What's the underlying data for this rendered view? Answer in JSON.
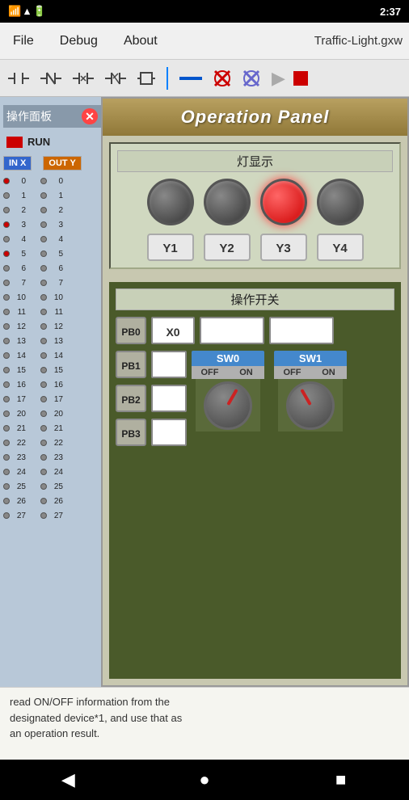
{
  "statusBar": {
    "time": "2:37",
    "icons": [
      "wifi",
      "signal",
      "battery"
    ]
  },
  "menuBar": {
    "file": "File",
    "debug": "Debug",
    "about": "About",
    "fileTitle": "Traffic-Light.gxw"
  },
  "toolbar": {
    "icons": [
      "contact-no",
      "contact-nc",
      "contact-p",
      "contact-n",
      "coil"
    ],
    "divider": true,
    "line": "—",
    "x1": "✕",
    "x2": "✕",
    "play": "▶",
    "stop": "■"
  },
  "leftPanel": {
    "title": "操作面板",
    "runLabel": "RUN",
    "inLabel": "IN X",
    "outLabel": "OUT Y",
    "ioRows": [
      {
        "in": "0",
        "inOn": true,
        "out": "0",
        "outOn": false
      },
      {
        "in": "1",
        "inOn": false,
        "out": "1",
        "outOn": false
      },
      {
        "in": "2",
        "inOn": false,
        "out": "2",
        "outOn": false
      },
      {
        "in": "3",
        "inOn": true,
        "out": "3",
        "outOn": false
      },
      {
        "in": "4",
        "inOn": false,
        "out": "4",
        "outOn": false
      },
      {
        "in": "5",
        "inOn": true,
        "out": "5",
        "outOn": false
      },
      {
        "in": "6",
        "inOn": false,
        "out": "6",
        "outOn": false
      },
      {
        "in": "7",
        "inOn": false,
        "out": "7",
        "outOn": false
      },
      {
        "in": "10",
        "inOn": false,
        "out": "10",
        "outOn": false
      },
      {
        "in": "11",
        "inOn": false,
        "out": "11",
        "outOn": false
      },
      {
        "in": "12",
        "inOn": false,
        "out": "12",
        "outOn": false
      },
      {
        "in": "13",
        "inOn": false,
        "out": "13",
        "outOn": false
      },
      {
        "in": "14",
        "inOn": false,
        "out": "14",
        "outOn": false
      },
      {
        "in": "15",
        "inOn": false,
        "out": "15",
        "outOn": false
      },
      {
        "in": "16",
        "inOn": false,
        "out": "16",
        "outOn": false
      },
      {
        "in": "17",
        "inOn": false,
        "out": "17",
        "outOn": false
      },
      {
        "in": "20",
        "inOn": false,
        "out": "20",
        "outOn": false
      },
      {
        "in": "21",
        "inOn": false,
        "out": "21",
        "outOn": false
      },
      {
        "in": "22",
        "inOn": false,
        "out": "22",
        "outOn": false
      },
      {
        "in": "23",
        "inOn": false,
        "out": "23",
        "outOn": false
      },
      {
        "in": "24",
        "inOn": false,
        "out": "24",
        "outOn": false
      },
      {
        "in": "25",
        "inOn": false,
        "out": "25",
        "outOn": false
      },
      {
        "in": "26",
        "inOn": false,
        "out": "26",
        "outOn": false
      },
      {
        "in": "27",
        "inOn": false,
        "out": "27",
        "outOn": false
      }
    ]
  },
  "operationPanel": {
    "title": "Operation Panel",
    "lightSection": {
      "label": "灯显示",
      "lights": [
        {
          "id": "Y1",
          "on": false
        },
        {
          "id": "Y2",
          "on": false
        },
        {
          "id": "Y3",
          "on": true
        },
        {
          "id": "Y4",
          "on": false
        }
      ]
    },
    "switchSection": {
      "label": "操作开关",
      "rows": [
        {
          "pb": "PB0",
          "x": "X0",
          "box1": "",
          "box2": ""
        },
        {
          "pb": "PB1",
          "x": "",
          "sw": "SW0"
        },
        {
          "pb": "PB2",
          "x": ""
        },
        {
          "pb": "PB3",
          "x": ""
        }
      ],
      "sw0": {
        "label": "SW0",
        "off": "OFF",
        "on": "ON"
      },
      "sw1": {
        "label": "SW1",
        "off": "OFF",
        "on": "ON"
      }
    }
  },
  "bottomText": {
    "line1": "read ON/OFF information from the",
    "line2": "designated device*1, and use that as",
    "line3": "an operation result."
  },
  "navBar": {
    "back": "◀",
    "home": "●",
    "recent": "■"
  }
}
